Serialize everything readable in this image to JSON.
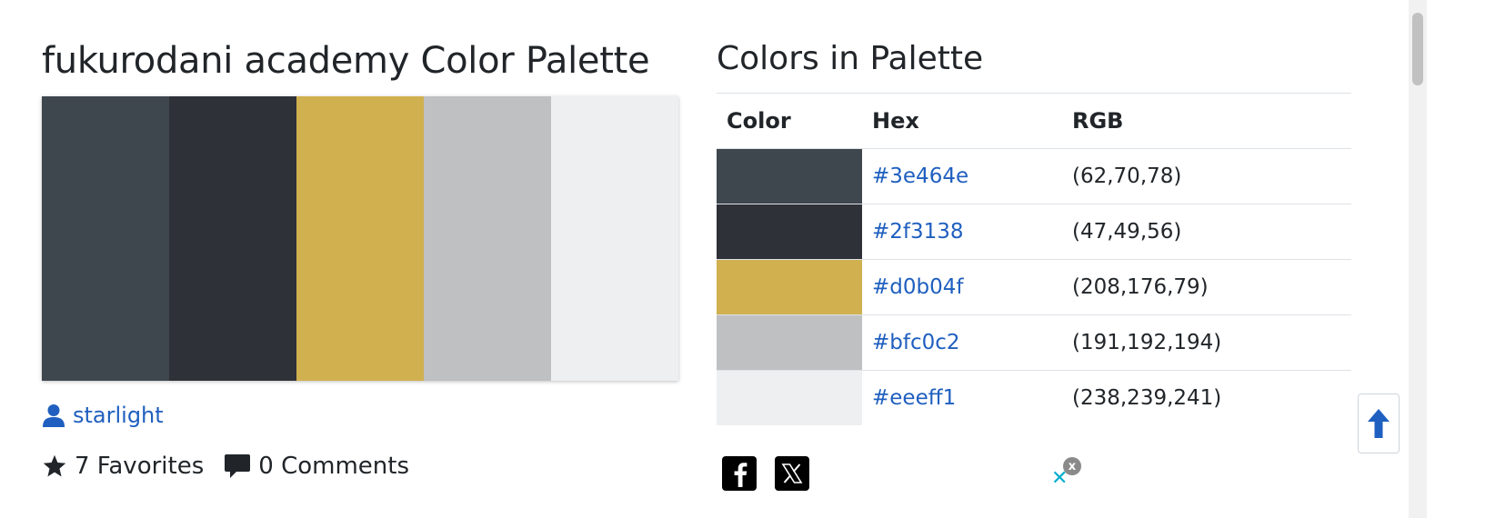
{
  "palette": {
    "title": "fukurodani academy Color Palette",
    "author": "starlight",
    "stats": {
      "favorites": "7 Favorites",
      "comments": "0 Comments"
    },
    "swatches": [
      "#3e464e",
      "#2f3138",
      "#d0b04f",
      "#bfc0c2",
      "#eeeff1"
    ]
  },
  "colors_section": {
    "title": "Colors in Palette",
    "headers": {
      "color": "Color",
      "hex": "Hex",
      "rgb": "RGB"
    },
    "rows": [
      {
        "swatch": "#3e464e",
        "hex": "#3e464e",
        "rgb": "(62,70,78)"
      },
      {
        "swatch": "#2f3138",
        "hex": "#2f3138",
        "rgb": "(47,49,56)"
      },
      {
        "swatch": "#d0b04f",
        "hex": "#d0b04f",
        "rgb": "(208,176,79)"
      },
      {
        "swatch": "#bfc0c2",
        "hex": "#bfc0c2",
        "rgb": "(191,192,194)"
      },
      {
        "swatch": "#eeeff1",
        "hex": "#eeeff1",
        "rgb": "(238,239,241)"
      }
    ]
  },
  "share": {
    "icons": [
      "facebook-icon",
      "x-icon"
    ]
  },
  "ad": {
    "close_label": "x"
  },
  "colors": {
    "link": "#1f5fbf",
    "back_to_top_arrow": "#1f5fbf"
  }
}
